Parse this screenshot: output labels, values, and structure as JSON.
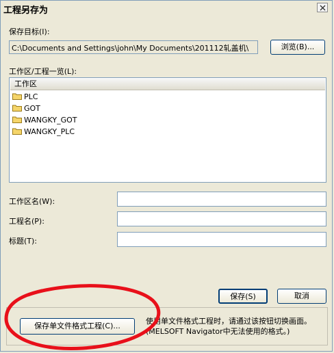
{
  "dialog": {
    "title": "工程另存为",
    "close_icon": "close-icon"
  },
  "save_target": {
    "label": "保存目标(I):",
    "path": "C:\\Documents and Settings\\john\\My Documents\\201112轧盖机\\",
    "browse_label": "浏览(B)..."
  },
  "workspace_list": {
    "label": "工作区/工程一览(L):",
    "header": "工作区",
    "items": [
      {
        "label": "PLC",
        "icon": "folder-icon"
      },
      {
        "label": "GOT",
        "icon": "folder-icon"
      },
      {
        "label": "WANGKY_GOT",
        "icon": "folder-icon"
      },
      {
        "label": "WANGKY_PLC",
        "icon": "folder-icon"
      }
    ]
  },
  "form": {
    "workspace_name_label": "工作区名(W):",
    "workspace_name_value": "",
    "project_name_label": "工程名(P):",
    "project_name_value": "",
    "title_label": "标题(T):",
    "title_value": ""
  },
  "actions": {
    "save_label": "保存(S)",
    "cancel_label": "取消",
    "single_file_label": "保存单文件格式工程(C)...",
    "note_line1": "使用单文件格式工程时，请通过该按钮切换画面。",
    "note_line2": "(MELSOFT Navigator中无法使用的格式。)"
  },
  "colors": {
    "dialog_bg": "#ece9d8",
    "annotation_red": "#e8101a",
    "folder_yellow": "#f5d56a"
  }
}
